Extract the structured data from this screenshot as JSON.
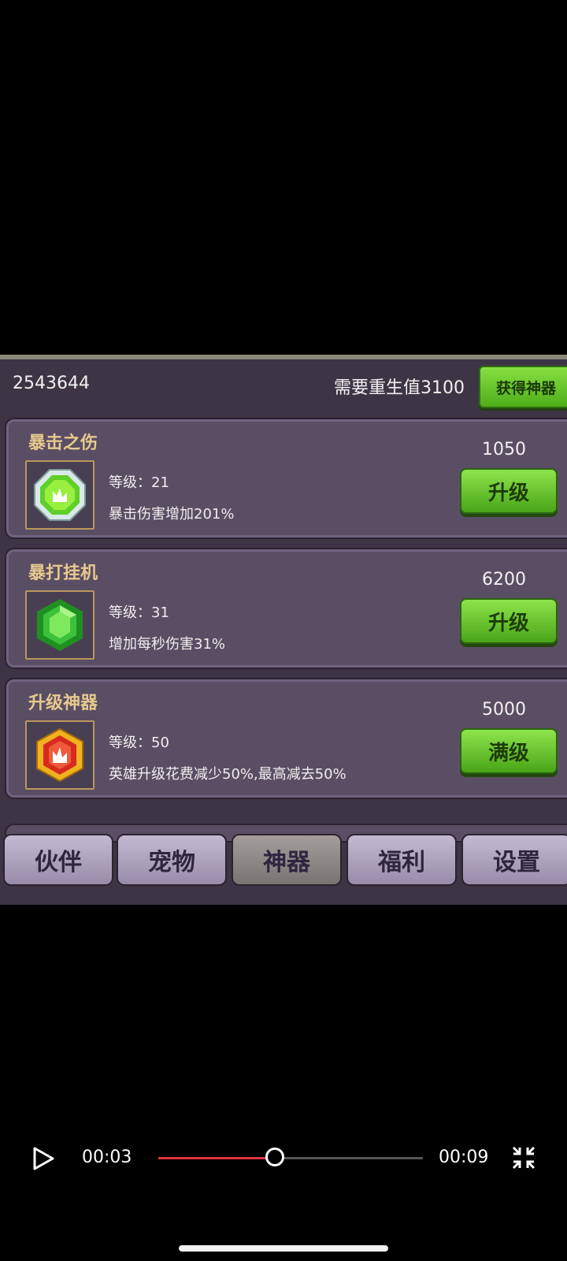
{
  "header": {
    "currency_value": "2543644",
    "rebirth_text": "需要重生值3100",
    "get_artifact_label": "获得神器"
  },
  "items": [
    {
      "name": "暴击之伤",
      "level": "等级：21",
      "desc": "暴击伤害增加201%",
      "cost": "1050",
      "button": "升级",
      "icon": "green-octagon-gem-icon"
    },
    {
      "name": "暴打挂机",
      "level": "等级：31",
      "desc": "增加每秒伤害31%",
      "cost": "6200",
      "button": "升级",
      "icon": "green-hexagon-gem-icon"
    },
    {
      "name": "升级神器",
      "level": "等级：50",
      "desc": "英雄升级花费减少50%,最高减去50%",
      "cost": "5000",
      "button": "满级",
      "icon": "red-hexagon-gem-icon"
    }
  ],
  "tabs": [
    {
      "label": "伙伴",
      "active": false
    },
    {
      "label": "宠物",
      "active": false
    },
    {
      "label": "神器",
      "active": true
    },
    {
      "label": "福利",
      "active": false
    },
    {
      "label": "设置",
      "active": false
    }
  ],
  "player": {
    "current_time": "00:03",
    "total_time": "00:09",
    "progress": 0.44,
    "accent_color": "#e3323f"
  }
}
